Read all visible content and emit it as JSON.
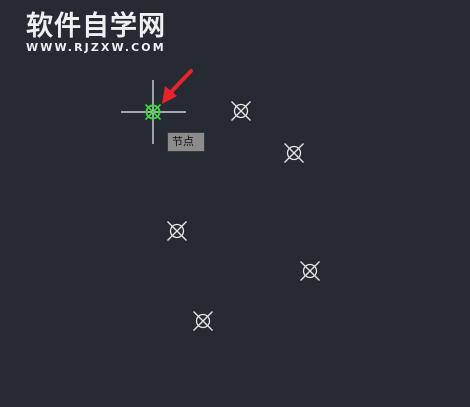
{
  "watermark": {
    "title": "软件自学网",
    "url": "WWW.RJZXW.COM"
  },
  "canvas": {
    "background": "#252a33",
    "node_color": "#e6e6e6",
    "snap_color": "#3fd43f",
    "cursor_color": "#f0f0f0",
    "arrow_color": "#e8232a"
  },
  "tooltip": {
    "label": "节点"
  },
  "icons": {
    "node_marker": "circle-x-point-icon",
    "snap_marker": "node-snap-marker-icon",
    "cursor": "crosshair-cursor-icon",
    "pointer": "red-arrow-icon"
  }
}
